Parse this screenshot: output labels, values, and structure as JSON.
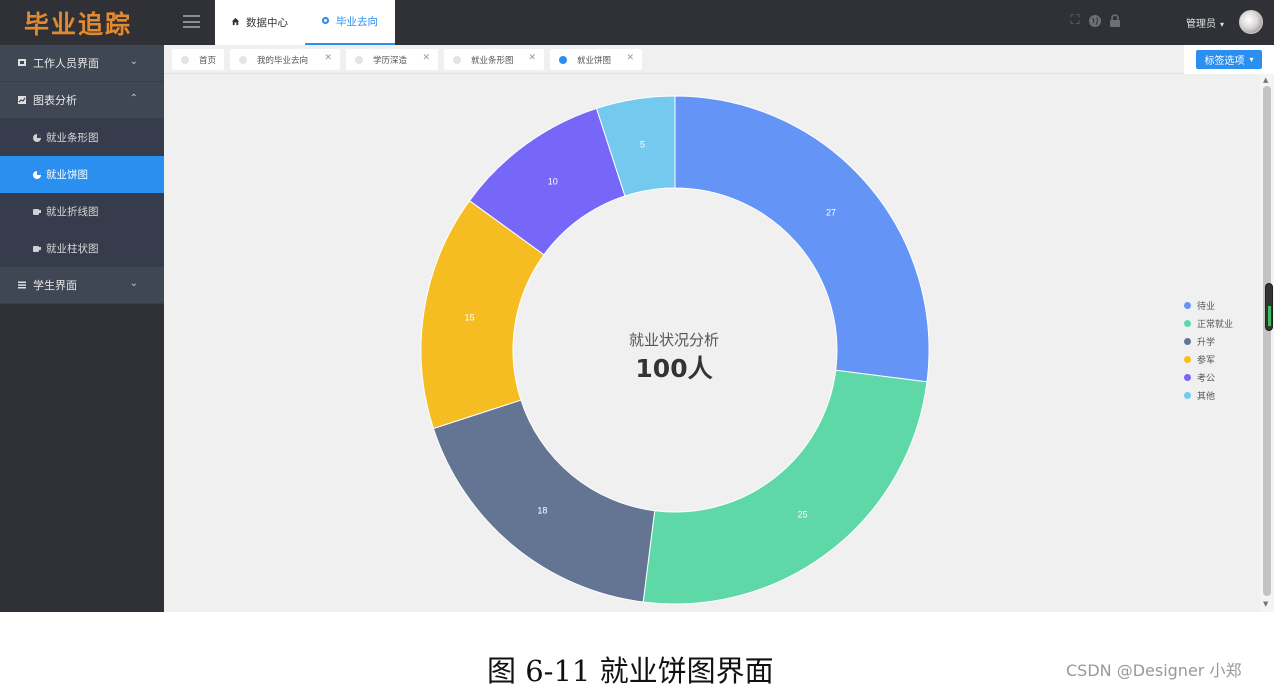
{
  "app": {
    "logo": "毕业追踪"
  },
  "sidebar": {
    "groups": [
      {
        "label": "工作人员界面",
        "expanded": false
      },
      {
        "label": "图表分析",
        "expanded": true,
        "items": [
          {
            "label": "就业条形图",
            "active": false
          },
          {
            "label": "就业饼图",
            "active": true
          },
          {
            "label": "就业折线图",
            "active": false
          },
          {
            "label": "就业柱状图",
            "active": false
          }
        ]
      },
      {
        "label": "学生界面",
        "expanded": false
      }
    ]
  },
  "topbar": {
    "tabs": [
      {
        "label": "数据中心",
        "active": false
      },
      {
        "label": "毕业去向",
        "active": true
      }
    ],
    "user": "管理员"
  },
  "tagbar": {
    "tags": [
      {
        "label": "首页",
        "closable": false,
        "active": false
      },
      {
        "label": "我的毕业去向",
        "closable": true,
        "active": false
      },
      {
        "label": "学历深造",
        "closable": true,
        "active": false
      },
      {
        "label": "就业条形图",
        "closable": true,
        "active": false
      },
      {
        "label": "就业饼图",
        "closable": true,
        "active": true
      }
    ],
    "options_button": "标签选项"
  },
  "chart_data": {
    "type": "pie",
    "donut": true,
    "center_title": "就业状况分析",
    "center_value": "100人",
    "legend_position": "right",
    "slices": [
      {
        "name": "待业",
        "value": 27,
        "color": "#6494f6"
      },
      {
        "name": "正常就业",
        "value": 25,
        "color": "#5fd8a8"
      },
      {
        "name": "升学",
        "value": 18,
        "color": "#647594"
      },
      {
        "name": "参军",
        "value": 15,
        "color": "#f5bd22"
      },
      {
        "name": "考公",
        "value": 10,
        "color": "#7667f9"
      },
      {
        "name": "其他",
        "value": 5,
        "color": "#74c9ee"
      }
    ]
  },
  "caption": "图 6-11  就业饼图界面",
  "watermark": "CSDN @Designer 小郑"
}
